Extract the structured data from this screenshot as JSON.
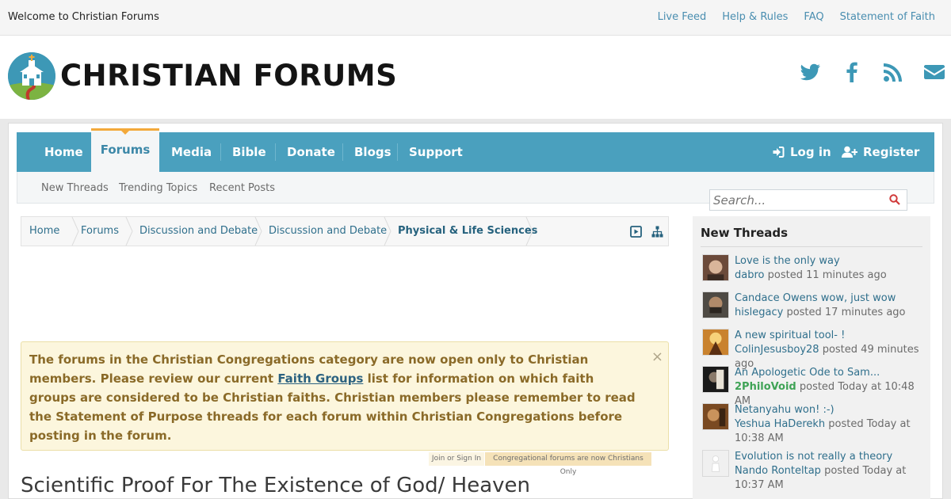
{
  "topbar": {
    "welcome": "Welcome to Christian Forums",
    "links": [
      "Live Feed",
      "Help & Rules",
      "FAQ",
      "Statement of Faith"
    ]
  },
  "header": {
    "site_title": "CHRISTIAN FORUMS",
    "social_icons": [
      "twitter-icon",
      "facebook-icon",
      "rss-icon",
      "mail-icon"
    ]
  },
  "nav": {
    "items": [
      "Home",
      "Forums",
      "Media",
      "Bible",
      "Donate",
      "Blogs",
      "Support"
    ],
    "active": "Forums",
    "login": "Log in",
    "register": "Register"
  },
  "subnav": {
    "items": [
      "New Threads",
      "Trending Topics",
      "Recent Posts"
    ]
  },
  "search": {
    "placeholder": "Search..."
  },
  "breadcrumb": {
    "items": [
      "Home",
      "Forums",
      "Discussion and Debate",
      "Discussion and Debate",
      "Physical & Life Sciences"
    ]
  },
  "notice": {
    "before_link": "The forums in the Christian Congregations category are now open only to Christian members. Please review our current ",
    "link": "Faith Groups",
    "after_link": " list for information on which faith groups are considered to be Christian faiths. Christian members please remember to read the Statement of Purpose threads for each forum within Christian Congregations before posting in the forum.",
    "close": "×",
    "tabs": [
      "Join or Sign In",
      "Congregational forums are now Christians Only"
    ]
  },
  "page": {
    "title": "Scientific Proof For The Existence of God/ Heaven"
  },
  "sidebar": {
    "title": "New Threads",
    "posted_word": "posted",
    "threads": [
      {
        "title": "Love is the only way",
        "user": "dabro",
        "time": "11 minutes ago"
      },
      {
        "title": "Candace Owens wow, just wow",
        "user": "hislegacy",
        "time": "17 minutes ago"
      },
      {
        "title": "A new spiritual tool- !",
        "user": "ColinJesusboy28",
        "time": "49 minutes ago"
      },
      {
        "title": "An Apologetic Ode to Sam...",
        "user": "2PhiloVoid",
        "time": "Today at 10:48 AM"
      },
      {
        "title": "Netanyahu won! :-)",
        "user": "Yeshua HaDerekh",
        "time": "Today at 10:38 AM"
      },
      {
        "title": "Evolution is not really a theory",
        "user": "Nando Ronteltap",
        "time": "Today at 10:37 AM"
      }
    ]
  },
  "colors": {
    "nav_bg": "#4aa0be",
    "accent": "#f3a93b",
    "link": "#2f6f8c",
    "notice_bg": "#fcf6dd",
    "notice_text": "#8a6a28"
  }
}
